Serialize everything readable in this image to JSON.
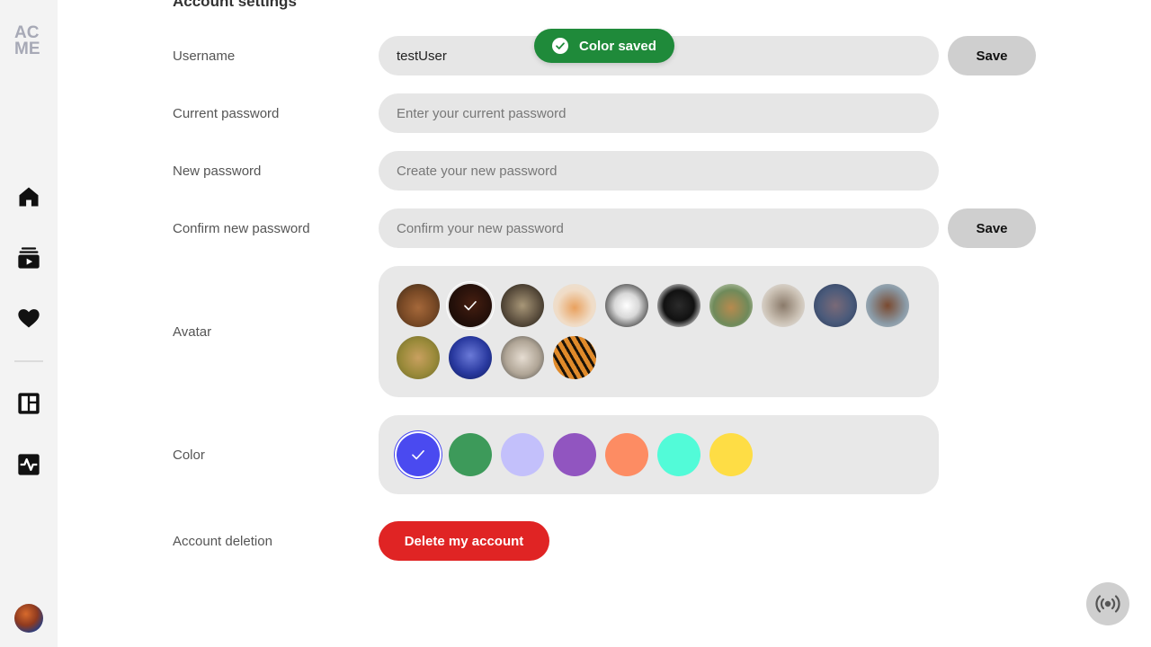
{
  "logo": {
    "line1": "AC",
    "line2": "ME"
  },
  "nav": [
    {
      "name": "home-icon"
    },
    {
      "name": "playlist-icon"
    },
    {
      "name": "heart-icon"
    },
    {
      "name": "dashboard-icon"
    },
    {
      "name": "activity-icon"
    }
  ],
  "page": {
    "title": "Account settings"
  },
  "toast": {
    "text": "Color saved",
    "color": "#1f8a3a"
  },
  "form": {
    "username": {
      "label": "Username",
      "value": "testUser",
      "save": "Save"
    },
    "current_password": {
      "label": "Current password",
      "placeholder": "Enter your current password"
    },
    "new_password": {
      "label": "New password",
      "placeholder": "Create your new password"
    },
    "confirm_password": {
      "label": "Confirm new password",
      "placeholder": "Confirm your new password",
      "save": "Save"
    },
    "avatar": {
      "label": "Avatar",
      "options": [
        {
          "name": "bear",
          "selected": false
        },
        {
          "name": "bird",
          "selected": true
        },
        {
          "name": "owl",
          "selected": false
        },
        {
          "name": "dog-shiba",
          "selected": false
        },
        {
          "name": "dog-pitbull",
          "selected": false
        },
        {
          "name": "dog-pug",
          "selected": false
        },
        {
          "name": "giraffe",
          "selected": false
        },
        {
          "name": "hedgehog",
          "selected": false
        },
        {
          "name": "hippo",
          "selected": false
        },
        {
          "name": "horse",
          "selected": false
        },
        {
          "name": "antelope",
          "selected": false
        },
        {
          "name": "jellyfish",
          "selected": false
        },
        {
          "name": "sheep",
          "selected": false
        },
        {
          "name": "tiger",
          "selected": false
        }
      ]
    },
    "color": {
      "label": "Color",
      "options": [
        {
          "hex": "#4a4af0",
          "selected": true
        },
        {
          "hex": "#3d9a5a",
          "selected": false
        },
        {
          "hex": "#c3c0fb",
          "selected": false
        },
        {
          "hex": "#9155c0",
          "selected": false
        },
        {
          "hex": "#fd8c63",
          "selected": false
        },
        {
          "hex": "#52fbd8",
          "selected": false
        },
        {
          "hex": "#fedd45",
          "selected": false
        }
      ]
    },
    "deletion": {
      "label": "Account deletion",
      "button": "Delete my account"
    }
  },
  "broadcast": {
    "icon": "broadcast-icon"
  }
}
